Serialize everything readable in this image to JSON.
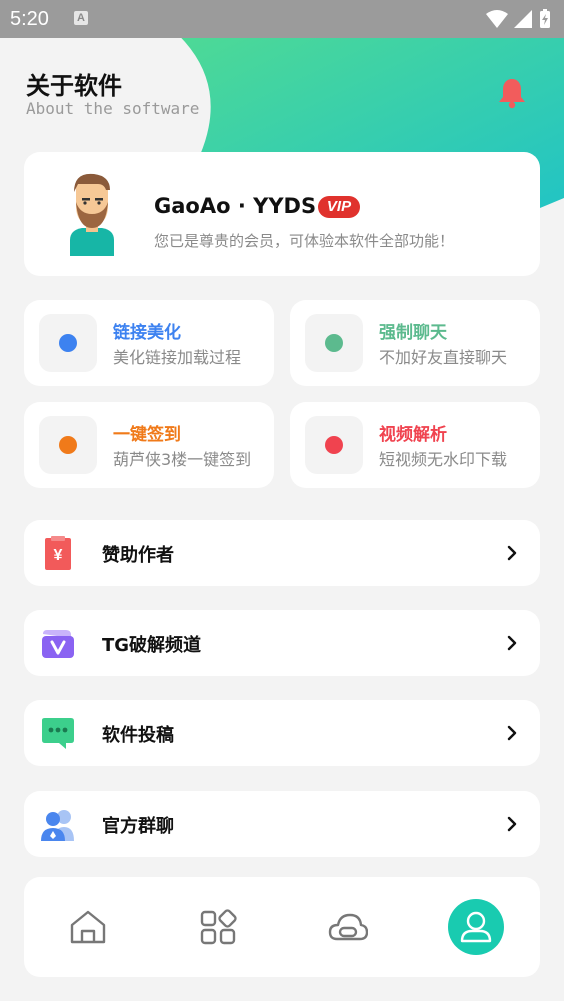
{
  "status_bar": {
    "time": "5:20",
    "indicator": "A"
  },
  "header": {
    "title": "关于软件",
    "subtitle": "About the software"
  },
  "profile": {
    "username": "GaoAo · YYDS",
    "badge": "VIP",
    "description": "您已是尊贵的会员，可体验本软件全部功能！"
  },
  "features": [
    {
      "title": "链接美化",
      "desc": "美化链接加载过程",
      "color": "#3d82f0"
    },
    {
      "title": "强制聊天",
      "desc": "不加好友直接聊天",
      "color": "#5cba8e"
    },
    {
      "title": "一键签到",
      "desc": "葫芦侠3楼一键签到",
      "color": "#f07a1a"
    },
    {
      "title": "视频解析",
      "desc": "短视频无水印下载",
      "color": "#f0434f"
    }
  ],
  "menu": [
    {
      "label": "赞助作者",
      "icon": "red-envelope-yen-icon"
    },
    {
      "label": "TG破解频道",
      "icon": "purple-folder-icon"
    },
    {
      "label": "软件投稿",
      "icon": "green-chat-bubble-icon"
    },
    {
      "label": "官方群聊",
      "icon": "blue-group-icon"
    }
  ],
  "tabbar": [
    {
      "icon": "home-icon",
      "active": false
    },
    {
      "icon": "apps-grid-icon",
      "active": false
    },
    {
      "icon": "cloud-icon",
      "active": false
    },
    {
      "icon": "user-icon",
      "active": true
    }
  ],
  "colors": {
    "accent": "#19cbb0",
    "vip": "#e0322d",
    "bell": "#f25c5c",
    "background": "#f3f3f3"
  }
}
